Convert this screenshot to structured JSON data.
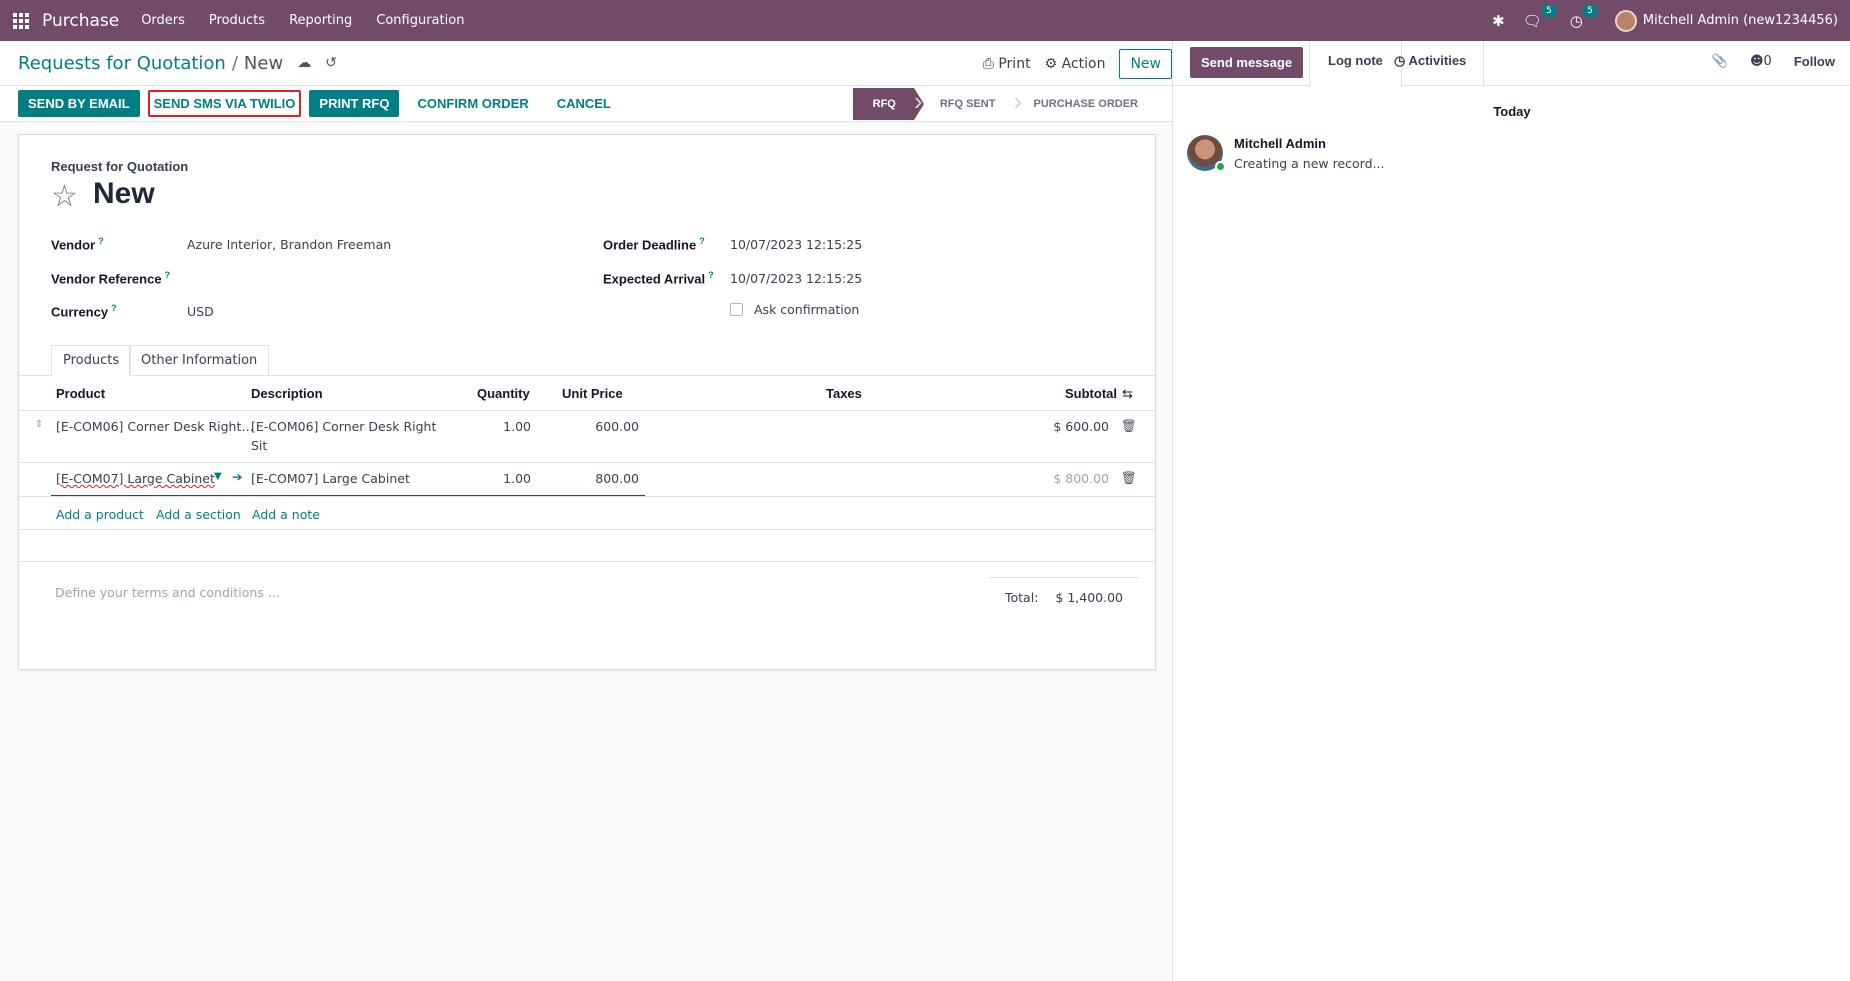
{
  "navbar": {
    "brand": "Purchase",
    "menus": [
      "Orders",
      "Products",
      "Reporting",
      "Configuration"
    ],
    "messages_count": "5",
    "activities_count": "5",
    "user": "Mitchell Admin (new1234456)"
  },
  "control_panel": {
    "breadcrumb_parent": "Requests for Quotation",
    "breadcrumb_sep": "/",
    "breadcrumb_current": "New",
    "print_label": "Print",
    "action_label": "Action",
    "new_label": "New"
  },
  "statusbar": {
    "buttons": [
      "SEND BY EMAIL",
      "SEND SMS VIA TWILIO",
      "PRINT RFQ",
      "CONFIRM ORDER",
      "CANCEL"
    ],
    "stages": [
      "RFQ",
      "RFQ SENT",
      "PURCHASE ORDER"
    ],
    "active_stage": "RFQ"
  },
  "form": {
    "type_label": "Request for Quotation",
    "title": "New",
    "vendor_label": "Vendor",
    "vendor_value": "Azure Interior, Brandon Freeman",
    "vendor_ref_label": "Vendor Reference",
    "vendor_ref_value": "",
    "currency_label": "Currency",
    "currency_value": "USD",
    "order_deadline_label": "Order Deadline",
    "order_deadline_value": "10/07/2023 12:15:25",
    "expected_arrival_label": "Expected Arrival",
    "expected_arrival_value": "10/07/2023 12:15:25",
    "ask_confirmation_label": "Ask confirmation",
    "help_mark": "?"
  },
  "tabs": [
    "Products",
    "Other Information"
  ],
  "lines": {
    "headers": {
      "product": "Product",
      "description": "Description",
      "quantity": "Quantity",
      "unit_price": "Unit Price",
      "taxes": "Taxes",
      "subtotal": "Subtotal"
    },
    "rows": [
      {
        "product": "[E-COM06] Corner Desk Right…",
        "description_line1": "[E-COM06] Corner Desk Right",
        "description_line2": "Sit",
        "quantity": "1.00",
        "unit_price": "600.00",
        "subtotal": "$ 600.00"
      },
      {
        "product": "[E-COM07] Large Cabinet",
        "description_line1": "[E-COM07] Large Cabinet",
        "description_line2": "",
        "quantity": "1.00",
        "unit_price": "800.00",
        "subtotal": "$ 800.00"
      }
    ],
    "add_links": [
      "Add a product",
      "Add a section",
      "Add a note"
    ]
  },
  "footer": {
    "terms_placeholder": "Define your terms and conditions ...",
    "total_label": "Total:",
    "total_value": "$ 1,400.00"
  },
  "chatter": {
    "send_message": "Send message",
    "log_note": "Log note",
    "activities": "Activities",
    "followers_count": "0",
    "follow": "Follow",
    "date_separator": "Today",
    "messages": [
      {
        "author": "Mitchell Admin",
        "body": "Creating a new record..."
      }
    ]
  },
  "colors": {
    "brand": "#714b67",
    "accent": "#017e84",
    "highlight_border": "#e02020"
  }
}
